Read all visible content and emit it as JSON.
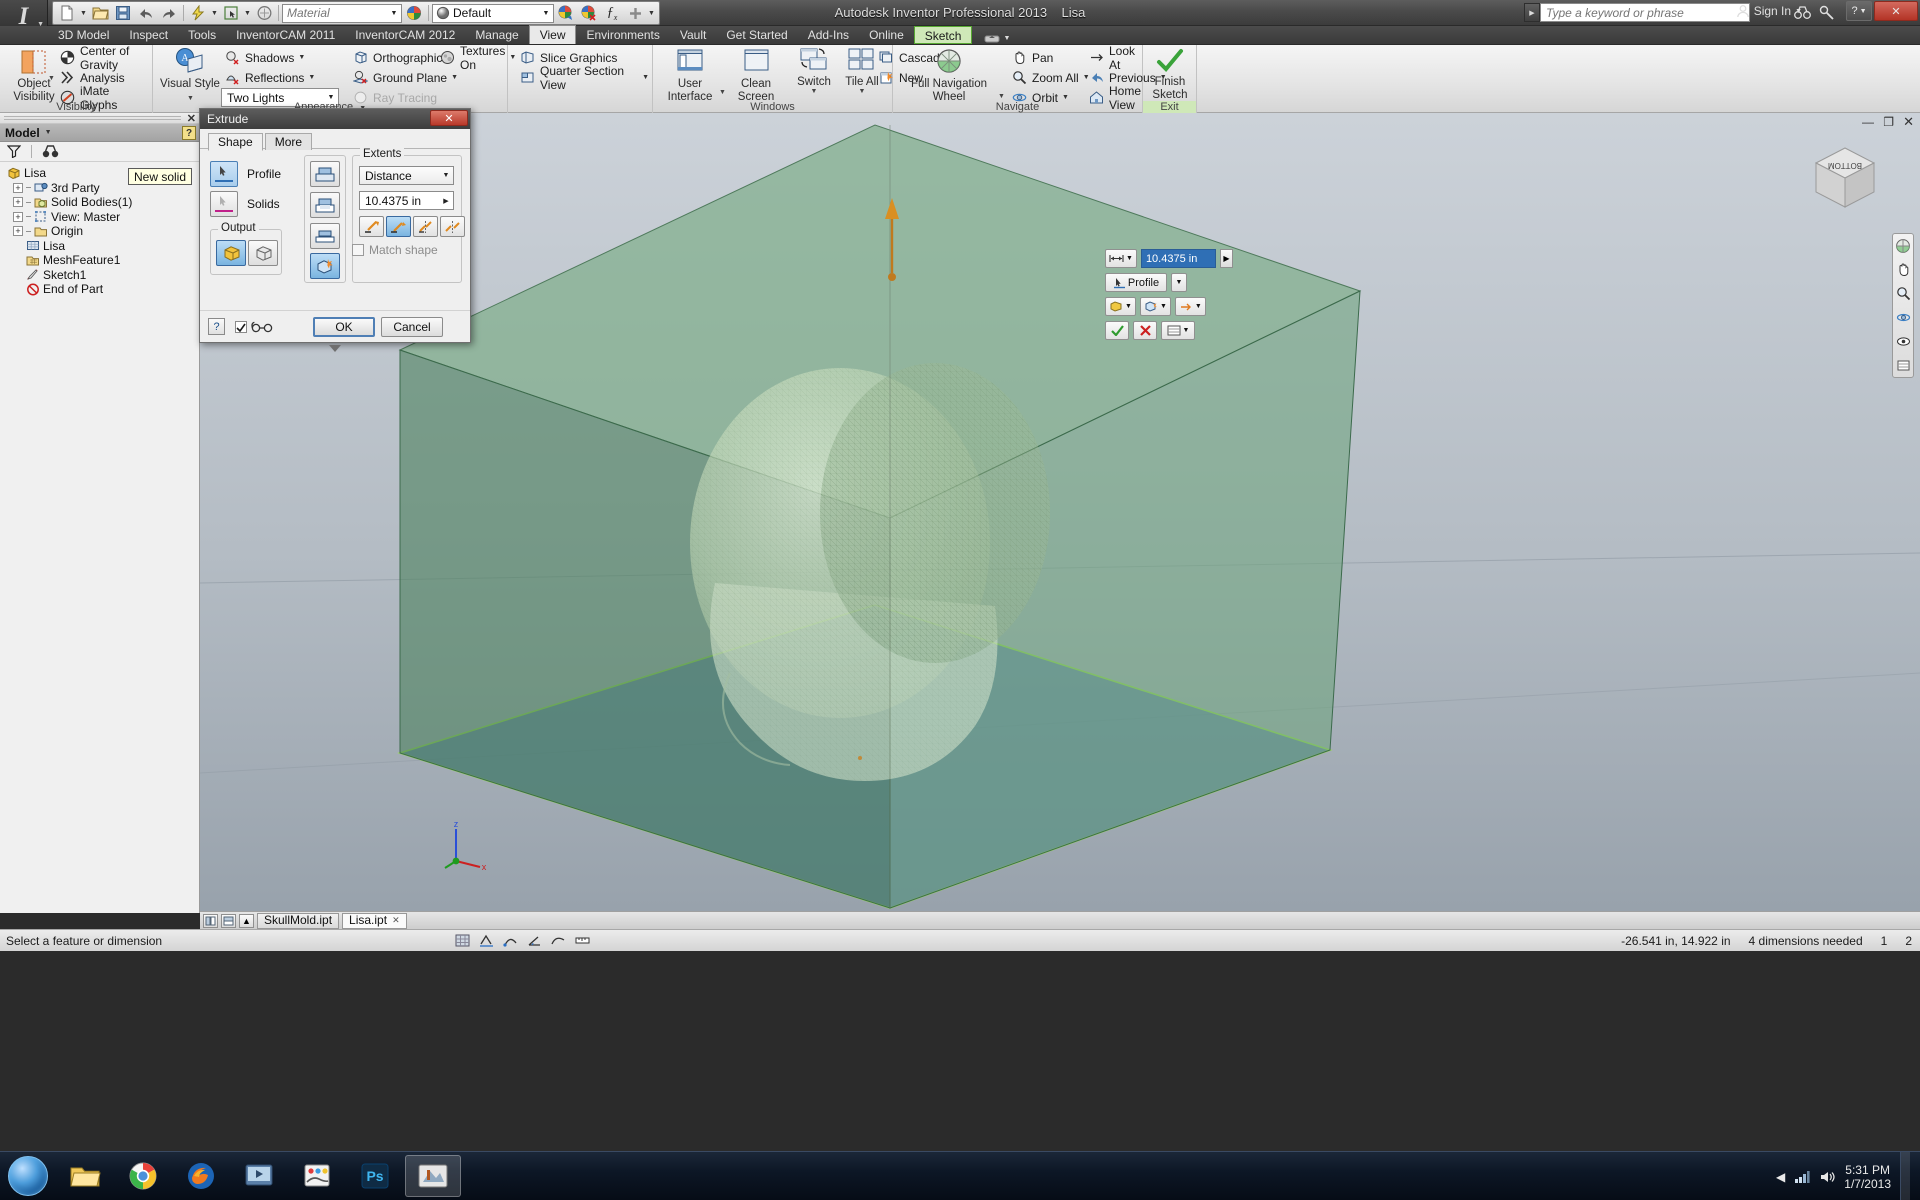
{
  "window": {
    "title": "Autodesk Inventor Professional 2013",
    "document_name": "Lisa",
    "minimize_label": "—",
    "maximize_label": "❐",
    "close_label": "✕"
  },
  "quick_access": {
    "material_placeholder": "Material",
    "appearance_value": "Default",
    "buttons": [
      "new-file",
      "open-file",
      "save",
      "undo",
      "redo",
      "update",
      "select",
      "return",
      "material-browser",
      "appearance-browser",
      "parameters",
      "add-to-qat"
    ]
  },
  "search": {
    "placeholder": "Type a keyword or phrase",
    "sign_in_label": "Sign In"
  },
  "tabs": [
    {
      "label": "3D Model",
      "state": "normal"
    },
    {
      "label": "Inspect",
      "state": "normal"
    },
    {
      "label": "Tools",
      "state": "normal"
    },
    {
      "label": "InventorCAM 2011",
      "state": "normal"
    },
    {
      "label": "InventorCAM 2012",
      "state": "normal"
    },
    {
      "label": "Manage",
      "state": "normal"
    },
    {
      "label": "View",
      "state": "active"
    },
    {
      "label": "Environments",
      "state": "normal"
    },
    {
      "label": "Vault",
      "state": "normal"
    },
    {
      "label": "Get Started",
      "state": "normal"
    },
    {
      "label": "Add-Ins",
      "state": "normal"
    },
    {
      "label": "Online",
      "state": "normal"
    },
    {
      "label": "Sketch",
      "state": "contextual"
    }
  ],
  "ribbon": {
    "panels": [
      {
        "name": "Visibility",
        "title": "Visibility",
        "big_button": {
          "label1": "Object",
          "label2": "Visibility"
        },
        "items": [
          "Center of Gravity",
          "Analysis",
          "iMate Glyphs"
        ]
      },
      {
        "name": "Appearance",
        "title": "Appearance",
        "big_button": {
          "label1": "Visual Style",
          "label2": ""
        },
        "items": [
          "Shadows",
          "Reflections",
          "Orthographic",
          "Ground Plane",
          "Textures On",
          "Ray Tracing"
        ],
        "lighting_style": "Two Lights"
      },
      {
        "name": "Sectioning",
        "title": "",
        "items": [
          "Slice Graphics",
          "Quarter Section View"
        ]
      },
      {
        "name": "Windows",
        "title": "Windows",
        "buttons": [
          {
            "label1": "User",
            "label2": "Interface"
          },
          {
            "label1": "Clean",
            "label2": "Screen"
          },
          {
            "label1": "Switch",
            "label2": ""
          },
          {
            "label1": "Tile All",
            "label2": ""
          }
        ],
        "items": [
          "Cascade",
          "New"
        ]
      },
      {
        "name": "Navigate",
        "title": "Navigate",
        "big_button": {
          "label1": "Full Navigation",
          "label2": "Wheel"
        },
        "items": [
          "Pan",
          "Zoom All",
          "Orbit",
          "Look At",
          "Previous",
          "Home View"
        ]
      },
      {
        "name": "Exit",
        "title": "Exit",
        "big_button": {
          "label1": "Finish",
          "label2": "Sketch"
        }
      }
    ]
  },
  "browser": {
    "header": "Model",
    "filter_icon": "filter-icon",
    "find_icon": "binoculars-icon",
    "tree": [
      {
        "label": "Lisa",
        "icon": "part-icon",
        "indent": 0,
        "expandable": false
      },
      {
        "label": "3rd Party",
        "icon": "third-party-icon",
        "indent": 1,
        "expandable": true
      },
      {
        "label": "Solid Bodies(1)",
        "icon": "solid-bodies-icon",
        "indent": 1,
        "expandable": true
      },
      {
        "label": "View: Master",
        "icon": "view-icon",
        "indent": 1,
        "expandable": true
      },
      {
        "label": "Origin",
        "icon": "folder-icon",
        "indent": 1,
        "expandable": true
      },
      {
        "label": "Lisa",
        "icon": "mesh-icon",
        "indent": 1,
        "expandable": false
      },
      {
        "label": "MeshFeature1",
        "icon": "mesh-feature-icon",
        "indent": 1,
        "expandable": false
      },
      {
        "label": "Sketch1",
        "icon": "sketch-icon",
        "indent": 1,
        "expandable": false
      },
      {
        "label": "End of Part",
        "icon": "end-of-part-icon",
        "indent": 1,
        "expandable": false
      }
    ]
  },
  "extrude_dialog": {
    "title": "Extrude",
    "close_label": "✕",
    "tabs": [
      {
        "label": "Shape",
        "active": true
      },
      {
        "label": "More",
        "active": false
      }
    ],
    "profile_label": "Profile",
    "solids_label": "Solids",
    "output_group_label": "Output",
    "output_options": [
      "solid",
      "surface"
    ],
    "output_selected": "solid",
    "boolean_options": [
      "join",
      "cut",
      "intersect",
      "new-solid"
    ],
    "boolean_selected": "new-solid",
    "extents_group_label": "Extents",
    "extents_type": "Distance",
    "distance_value": "10.4375 in",
    "direction_options": [
      "direction-1",
      "direction-2",
      "symmetric",
      "asymmetric"
    ],
    "direction_selected": "direction-2",
    "match_shape_label": "Match shape",
    "match_shape_checked": false,
    "tooltip": "New solid",
    "help_label": "?",
    "ok_label": "OK",
    "cancel_label": "Cancel"
  },
  "hud": {
    "distance_value": "10.4375 in",
    "profile_label": "Profile",
    "ok_icon": "check-icon",
    "cancel_icon": "x-icon",
    "options_icon": "list-icon"
  },
  "viewcube": {
    "face_label": "BOTTOM"
  },
  "doc_tabs": [
    {
      "label": "SkullMold.ipt",
      "active": false
    },
    {
      "label": "Lisa.ipt",
      "active": true,
      "close": "✕"
    }
  ],
  "status_bar": {
    "message": "Select a feature or dimension",
    "coordinates": "-26.541 in, 14.922 in",
    "dimensions_needed": "4 dimensions needed",
    "count_1": "1",
    "count_2": "2"
  },
  "taskbar": {
    "clock_time": "5:31 PM",
    "clock_date": "1/7/2013",
    "items": [
      {
        "name": "file-explorer",
        "active": false
      },
      {
        "name": "chrome-browser",
        "active": false
      },
      {
        "name": "firefox-browser",
        "active": false
      },
      {
        "name": "media-player",
        "active": false
      },
      {
        "name": "paint",
        "active": false
      },
      {
        "name": "photoshop",
        "active": false
      },
      {
        "name": "inventor",
        "active": true
      }
    ]
  },
  "colors": {
    "accent_blue": "#2f6fb5",
    "sketch_green": "#57a832",
    "box_green": "#5d8f6d",
    "box_blue": "#3d6c9c",
    "title_dark": "#3d3d3d"
  }
}
